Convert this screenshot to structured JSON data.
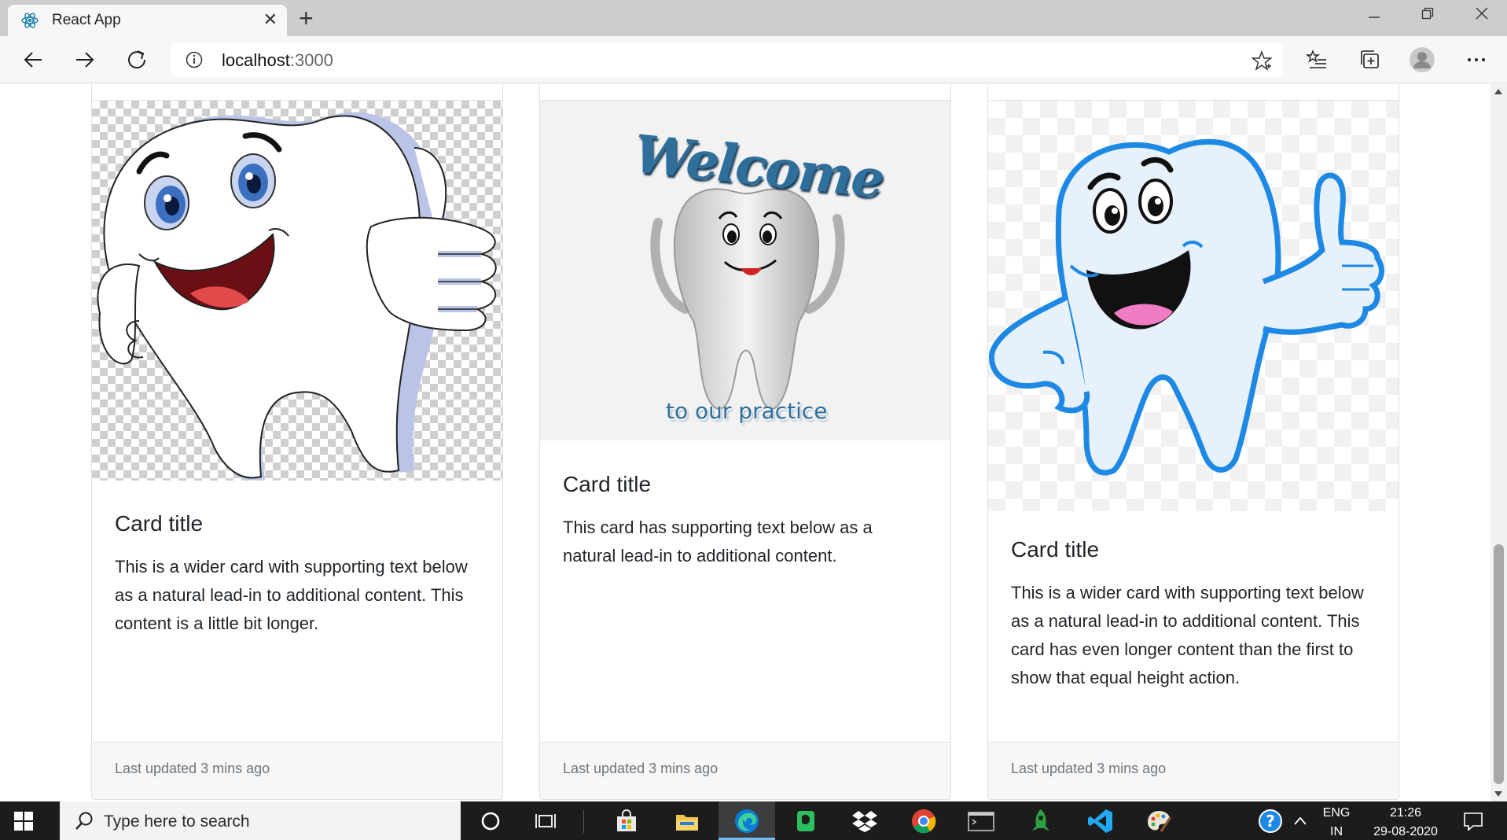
{
  "browser": {
    "tab_title": "React App",
    "tab_close": "✕",
    "new_tab": "+",
    "url_host": "localhost",
    "url_port": ":3000"
  },
  "cards": [
    {
      "image_alt": "Cartoon tooth giving a thumbs up",
      "title": "Card title",
      "text": "This is a wider card with supporting text below as a natural lead-in to additional content. This content is a little bit longer.",
      "footer": "Last updated 3 mins ago"
    },
    {
      "image_alt": "Welcome to our practice tooth",
      "image_text_top": "Welcome",
      "image_text_bottom": "to our practice",
      "title": "Card title",
      "text": "This card has supporting text below as a natural lead-in to additional content.",
      "footer": "Last updated 3 mins ago"
    },
    {
      "image_alt": "Blue cartoon tooth giving a thumbs up",
      "title": "Card title",
      "text": "This is a wider card with supporting text below as a natural lead-in to additional content. This card has even longer content than the first to show that equal height action.",
      "footer": "Last updated 3 mins ago"
    }
  ],
  "taskbar": {
    "search_placeholder": "Type here to search",
    "lang_line1": "ENG",
    "lang_line2": "IN",
    "time": "21:26",
    "date": "29-08-2020"
  },
  "colors": {
    "edge_blue": "#0078d7",
    "tooth_outline_blue": "#1e88e5",
    "footer_text": "#6c757d"
  }
}
